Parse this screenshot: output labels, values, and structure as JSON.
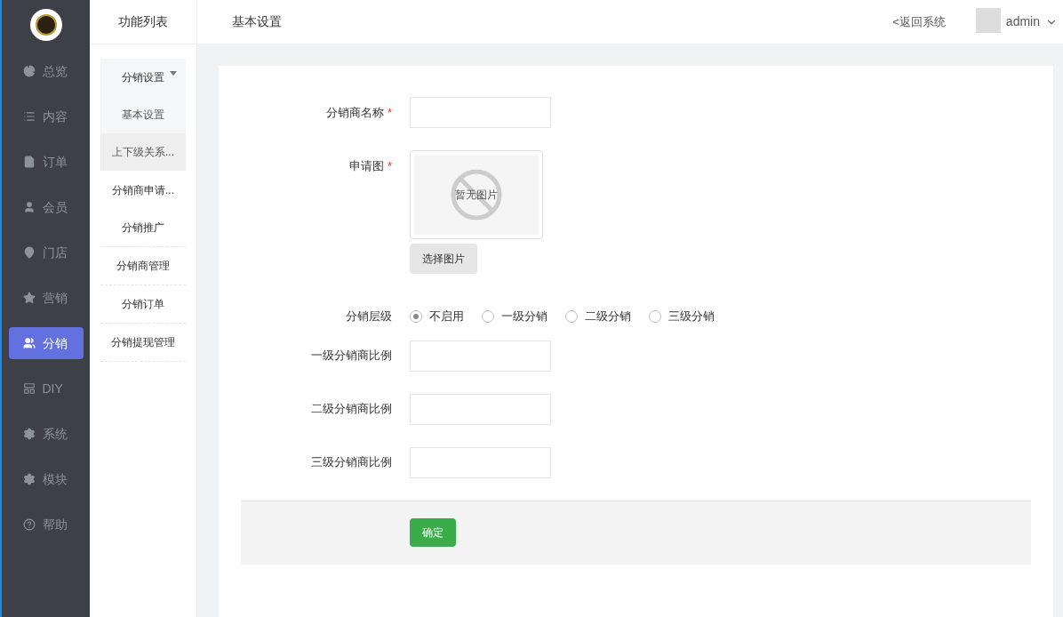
{
  "nav": [
    {
      "label": "总览",
      "selected": false
    },
    {
      "label": "内容",
      "selected": false
    },
    {
      "label": "订单",
      "selected": false
    },
    {
      "label": "会员",
      "selected": false
    },
    {
      "label": "门店",
      "selected": false
    },
    {
      "label": "营销",
      "selected": false
    },
    {
      "label": "分销",
      "selected": true
    },
    {
      "label": "DIY",
      "selected": false
    },
    {
      "label": "系统",
      "selected": false
    },
    {
      "label": "模块",
      "selected": false
    },
    {
      "label": "帮助",
      "selected": false
    }
  ],
  "submenu": {
    "title": "功能列表",
    "group": {
      "label": "分销设置",
      "expanded": true,
      "children": [
        {
          "label": "基本设置",
          "selected": false
        },
        {
          "label": "上下级关系...",
          "selected": true
        }
      ]
    },
    "items": [
      {
        "label": "分销商申请..."
      },
      {
        "label": "分销推广"
      },
      {
        "label": "分销商管理"
      },
      {
        "label": "分销订单"
      },
      {
        "label": "分销提现管理"
      }
    ]
  },
  "header": {
    "title": "基本设置",
    "back_link": "<返回系统",
    "user": "admin"
  },
  "form": {
    "name_label": "分销商名称",
    "name_required_mark": "*",
    "image_label": "申请图",
    "image_required_mark": "*",
    "image_placeholder": "暂无图片",
    "choose_button": "选择图片",
    "level_label": "分销层级",
    "level_options": [
      {
        "label": "不启用",
        "selected": true
      },
      {
        "label": "一级分销",
        "selected": false
      },
      {
        "label": "二级分销",
        "selected": false
      },
      {
        "label": "三级分销",
        "selected": false
      }
    ],
    "ratios": [
      {
        "label": "一级分销商比例"
      },
      {
        "label": "二级分销商比例"
      },
      {
        "label": "三级分销商比例"
      }
    ],
    "submit": "确定"
  }
}
